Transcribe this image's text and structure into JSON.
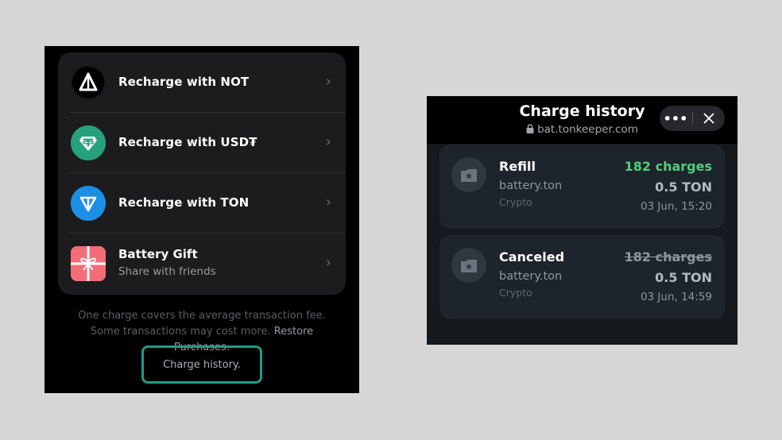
{
  "left": {
    "options": [
      {
        "label": "Recharge with NOT",
        "icon": "not-coin-icon",
        "color": "#000000"
      },
      {
        "label": "Recharge with USD₮",
        "icon": "tether-icon",
        "color": "#26a17b"
      },
      {
        "label": "Recharge with TON",
        "icon": "ton-icon",
        "color": "#1b8fe6"
      },
      {
        "label": "Battery Gift",
        "sublabel": "Share with friends",
        "icon": "gift-icon",
        "color": "#f26d78"
      }
    ],
    "chevron": "›",
    "footnote_text": "One charge covers the average transaction fee. Some transactions may cost more.",
    "restore_link": "Restore Purchases.",
    "history_link": "Charge history.",
    "highlight_color": "#1f9d84"
  },
  "right": {
    "title": "Charge history",
    "url": "bat.tonkeeper.com",
    "more_label": "•••",
    "entries": [
      {
        "title": "Refill",
        "source": "battery.ton",
        "kind": "Crypto",
        "charges": "182 charges",
        "charges_color": "#4cd07d",
        "amount": "0.5 TON",
        "date": "03 Jun, 15:20",
        "icon": "star-icon"
      },
      {
        "title": "Canceled",
        "source": "battery.ton",
        "kind": "Crypto",
        "charges": "182 charges",
        "charges_color": "#8e959e",
        "amount": "0.5 TON",
        "date": "03 Jun, 14:59",
        "icon": "star-icon"
      }
    ]
  }
}
